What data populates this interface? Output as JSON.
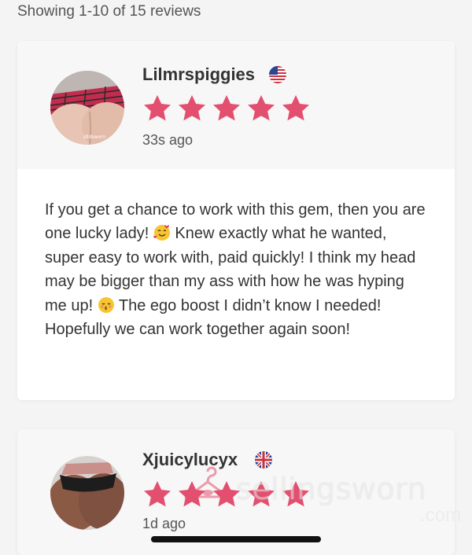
{
  "summary": "Showing 1-10 of 15 reviews",
  "colors": {
    "star": "#e3506f",
    "card_head": "#f7f7f8",
    "background": "#f4f4f5"
  },
  "reviews": [
    {
      "username": "Lilmrspiggies",
      "flag": "us-flag-icon",
      "rating": 5,
      "time": "33s ago",
      "text_parts": [
        "If you get a chance to work with this gem, then you are one lucky lady! ",
        " Knew exactly what he wanted, super easy to work with, paid quickly! I think my head may be bigger than my ass with how he was hyping me up! ",
        " The ego boost I didn’t know I needed! Hopefully we can work together again soon!"
      ]
    },
    {
      "username": "Xjuicylucyx",
      "flag": "uk-flag-icon",
      "rating": 5,
      "time": "1d ago"
    }
  ],
  "watermark": {
    "text": "sellingsworn",
    "suffix": ".com"
  }
}
